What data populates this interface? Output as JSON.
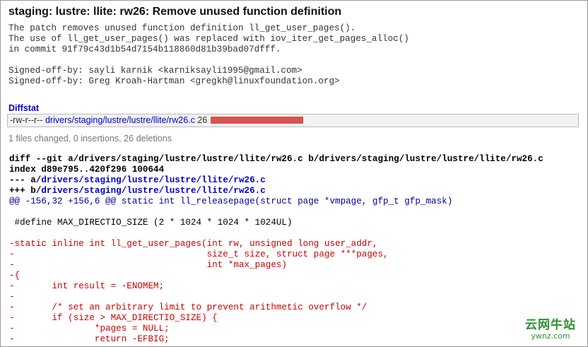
{
  "commit": {
    "title": "staging: lustre: llite: rw26: Remove unused function definition",
    "message": "The patch removes unused function definition ll_get_user_pages().\nThe use of ll_get_user_pages() was replaced with iov_iter_get_pages_alloc()\nin commit 91f79c43d1b54d7154b118860d81b39bad07dfff.\n\nSigned-off-by: sayli karnik <karniksayli1995@gmail.com>\nSigned-off-by: Greg Kroah-Hartman <gregkh@linuxfoundation.org>"
  },
  "diffstat": {
    "heading": "Diffstat",
    "mode": "-rw-r--r--",
    "file": "drivers/staging/lustre/lustre/llite/rw26.c",
    "count": "26",
    "bar_fraction": 1.0,
    "bar_color": "#d9534f",
    "summary": "1 files changed, 0 insertions, 26 deletions"
  },
  "diff": {
    "git_line": "diff --git a/drivers/staging/lustre/lustre/llite/rw26.c b/drivers/staging/lustre/lustre/llite/rw26.c",
    "index_line": "index d89e795..420f296 100644",
    "minus_prefix": "--- a/",
    "plus_prefix": "+++ b/",
    "file_path": "drivers/staging/lustre/lustre/llite/rw26.c",
    "hunk": "@@ -156,32 +156,6 @@ static int ll_releasepage(struct page *vmpage, gfp_t gfp_mask)",
    "context": " #define MAX_DIRECTIO_SIZE (2 * 1024 * 1024 * 1024UL)",
    "deleted": [
      "-static inline int ll_get_user_pages(int rw, unsigned long user_addr,",
      "-                                    size_t size, struct page ***pages,",
      "-                                    int *max_pages)",
      "-{",
      "-       int result = -ENOMEM;",
      "-",
      "-       /* set an arbitrary limit to prevent arithmetic overflow */",
      "-       if (size > MAX_DIRECTIO_SIZE) {",
      "-               *pages = NULL;",
      "-               return -EFBIG;"
    ]
  },
  "watermark": {
    "line1": "云网牛站",
    "line2": "ywnz.com",
    "color": "#2f8f2f"
  }
}
